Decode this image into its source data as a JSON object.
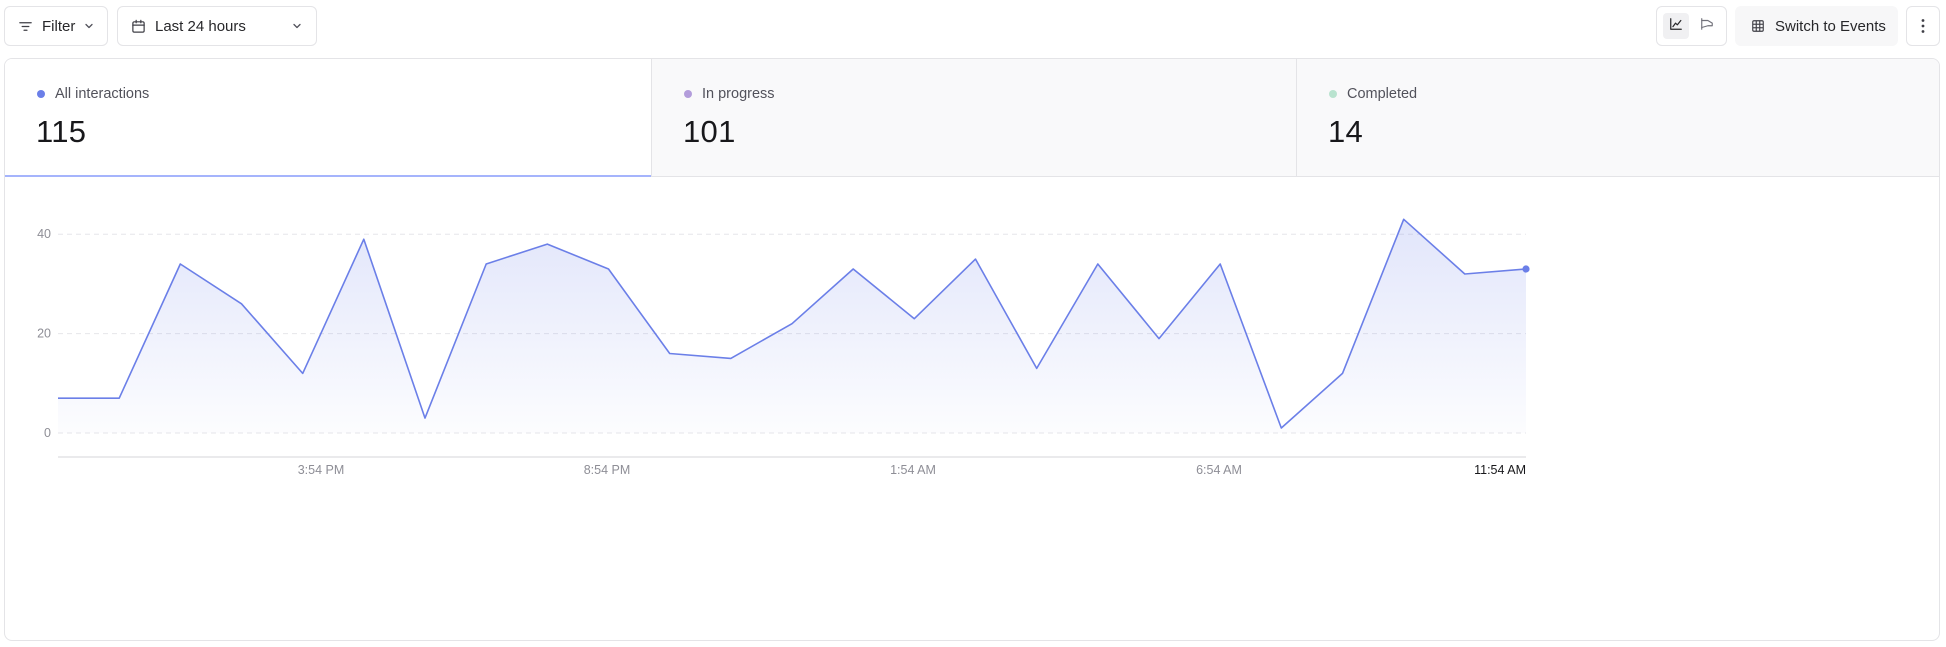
{
  "toolbar": {
    "filter_label": "Filter",
    "range_label": "Last 24 hours",
    "switch_label": "Switch to Events",
    "icons": [
      "filter-icon",
      "calendar-icon",
      "chevron-down-icon",
      "line-chart-icon",
      "funnel-icon",
      "table-icon",
      "more-vertical-icon"
    ]
  },
  "stats": [
    {
      "label": "All interactions",
      "value": "115",
      "color": "#6b7fe8",
      "active": true
    },
    {
      "label": "In progress",
      "value": "101",
      "color": "#b39ddb",
      "active": false
    },
    {
      "label": "Completed",
      "value": "14",
      "color": "#b9e3cf",
      "active": false
    }
  ],
  "chart_data": {
    "type": "area",
    "title": "",
    "xlabel": "",
    "ylabel": "",
    "x_tick_labels": [
      "3:54 PM",
      "8:54 PM",
      "1:54 AM",
      "6:54 AM",
      "11:54 AM"
    ],
    "y_ticks": [
      0,
      20,
      40
    ],
    "ylim": [
      0,
      50
    ],
    "grid": true,
    "line_color": "#6b7fe8",
    "series": [
      {
        "name": "All interactions",
        "values": [
          7,
          7,
          34,
          26,
          12,
          39,
          3,
          34,
          38,
          33,
          16,
          15,
          22,
          33,
          23,
          35,
          13,
          34,
          19,
          34,
          1,
          12,
          43,
          32,
          33
        ]
      }
    ]
  }
}
